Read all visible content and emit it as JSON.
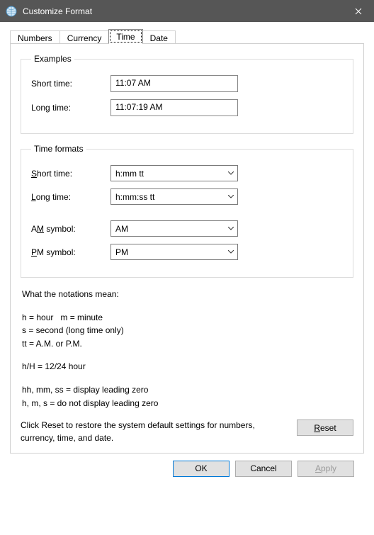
{
  "window": {
    "title": "Customize Format"
  },
  "tabs": {
    "numbers": "Numbers",
    "currency": "Currency",
    "time": "Time",
    "date": "Date",
    "active": "time"
  },
  "examples": {
    "legend": "Examples",
    "short_time_label": "Short time:",
    "short_time_value": "11:07 AM",
    "long_time_label": "Long time:",
    "long_time_value": "11:07:19 AM"
  },
  "formats": {
    "legend": "Time formats",
    "short_time_label": "Short time:",
    "short_time_value": "h:mm tt",
    "long_time_label": "Long time:",
    "long_time_value": "h:mm:ss tt",
    "am_symbol_label": "AM symbol:",
    "am_symbol_value": "AM",
    "pm_symbol_label": "PM symbol:",
    "pm_symbol_value": "PM"
  },
  "notations": {
    "heading": "What the notations mean:",
    "line1": "h = hour   m = minute",
    "line2": "s = second (long time only)",
    "line3": "tt = A.M. or P.M.",
    "line4": "h/H = 12/24 hour",
    "line5": "hh, mm, ss = display leading zero",
    "line6": "h, m, s = do not display leading zero"
  },
  "reset": {
    "text": "Click Reset to restore the system default settings for numbers, currency, time, and date.",
    "button": "Reset"
  },
  "buttons": {
    "ok": "OK",
    "cancel": "Cancel",
    "apply": "Apply"
  }
}
